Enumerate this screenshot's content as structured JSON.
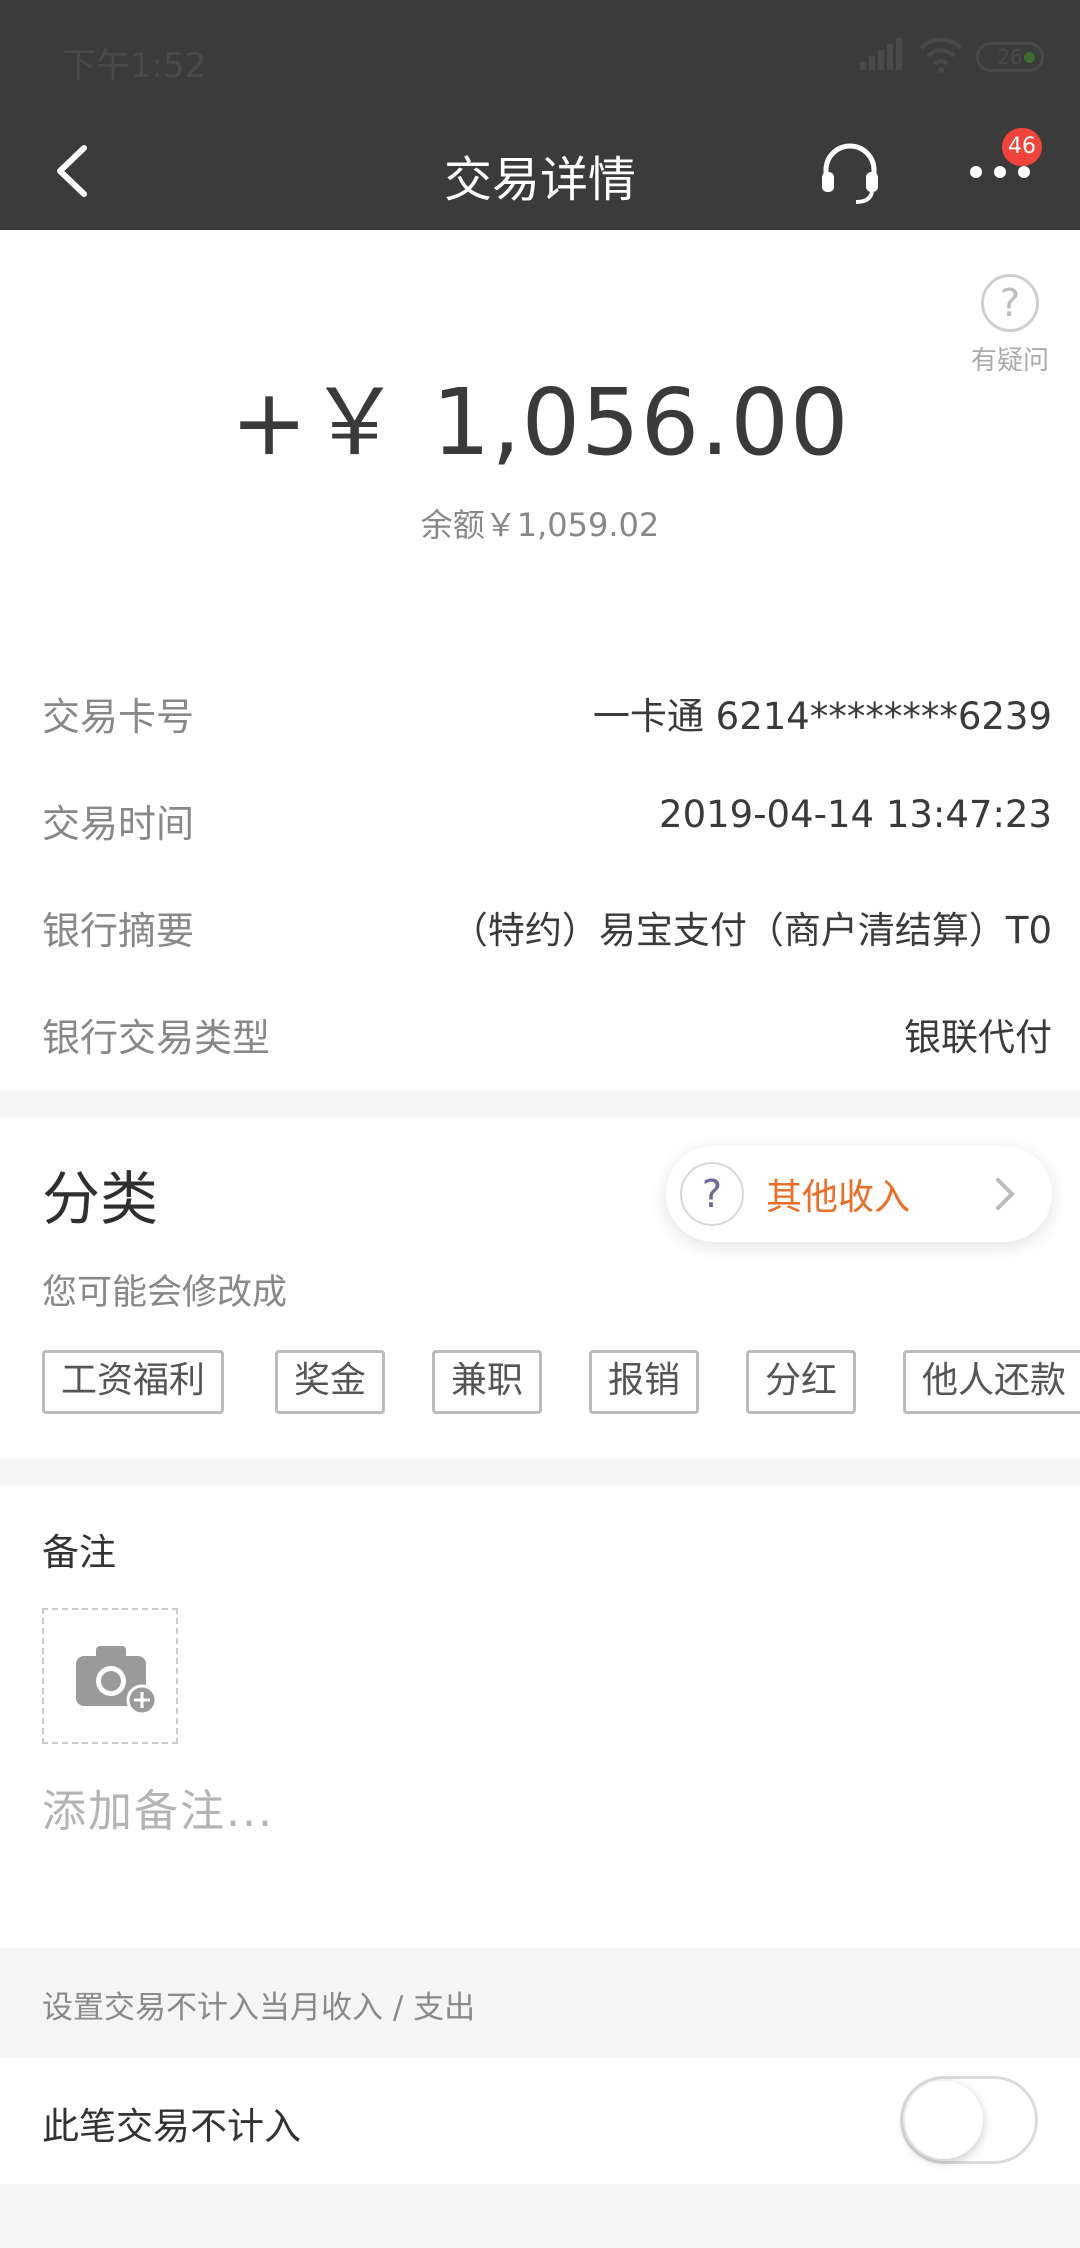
{
  "status_bar": {
    "time": "下午1:52",
    "battery": "26"
  },
  "nav": {
    "title": "交易详情",
    "badge_count": "46"
  },
  "amount_section": {
    "help_label": "有疑问",
    "amount": "+￥ 1,056.00",
    "balance": "余额￥1,059.02"
  },
  "details": [
    {
      "label": "交易卡号",
      "value": "一卡通 6214********6239"
    },
    {
      "label": "交易时间",
      "value": "2019-04-14 13:47:23"
    },
    {
      "label": "银行摘要",
      "value": "（特约）易宝支付（商户清结算）T0"
    },
    {
      "label": "银行交易类型",
      "value": "银联代付"
    }
  ],
  "category": {
    "title": "分类",
    "help_glyph": "?",
    "selected": "其他收入",
    "hint": "您可能会修改成",
    "tags": [
      "工资福利",
      "奖金",
      "兼职",
      "报销",
      "分红",
      "他人还款"
    ]
  },
  "note": {
    "title": "备注",
    "placeholder": "添加备注..."
  },
  "exclude": {
    "hint": "设置交易不计入当月收入 / 支出",
    "label": "此笔交易不计入",
    "enabled": false
  },
  "colors": {
    "header_bg": "#3b3b3b",
    "accent_orange": "#ef6c24",
    "badge_red": "#f0443a"
  }
}
